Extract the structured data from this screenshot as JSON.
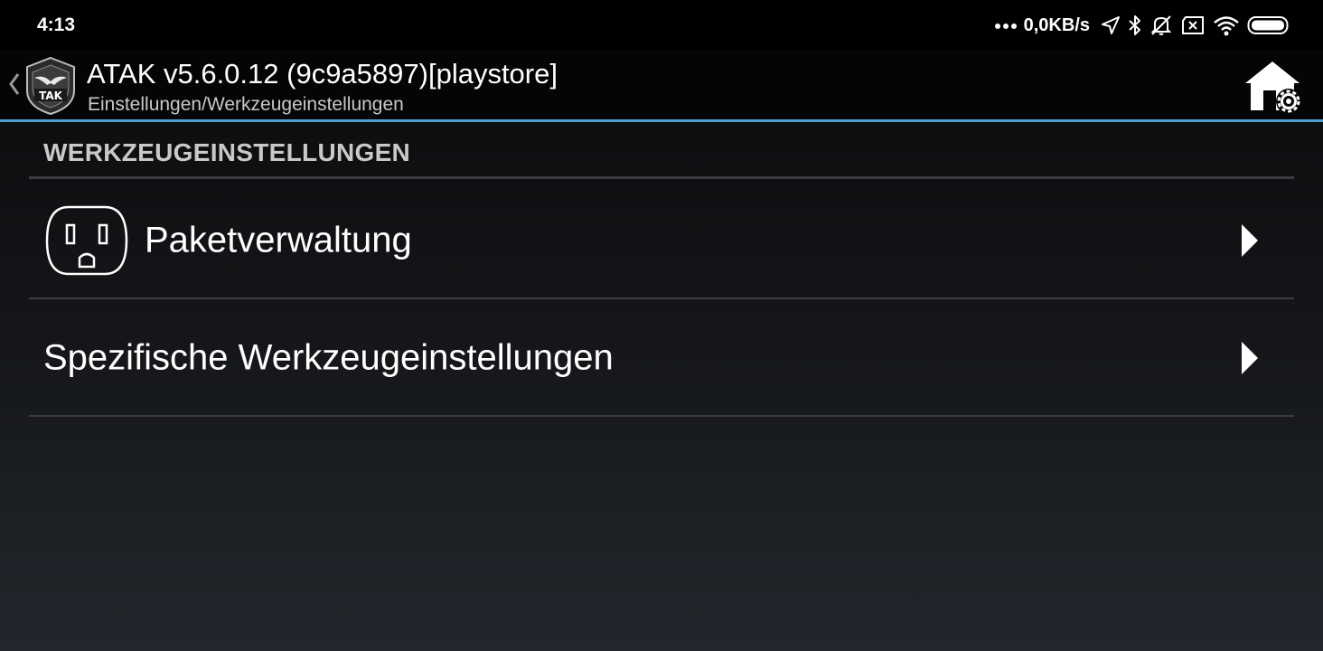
{
  "status_bar": {
    "time": "4:13",
    "network_speed": "0,0KB/s",
    "icons": [
      "more-dots-icon",
      "location-arrow-icon",
      "bluetooth-icon",
      "notifications-off-icon",
      "sim-missing-icon",
      "wifi-icon",
      "battery-icon"
    ]
  },
  "action_bar": {
    "title": "ATAK v5.6.0.12 (9c9a5897)[playstore]",
    "subtitle": "Einstellungen/Werkzeugeinstellungen",
    "logo_text": "TAK",
    "accent_color": "#4a9fcf"
  },
  "content": {
    "section_title": "WERKZEUGEINSTELLUNGEN",
    "items": [
      {
        "label": "Paketverwaltung",
        "icon": "power-outlet-icon"
      },
      {
        "label": "Spezifische Werkzeugeinstellungen",
        "icon": ""
      }
    ]
  }
}
